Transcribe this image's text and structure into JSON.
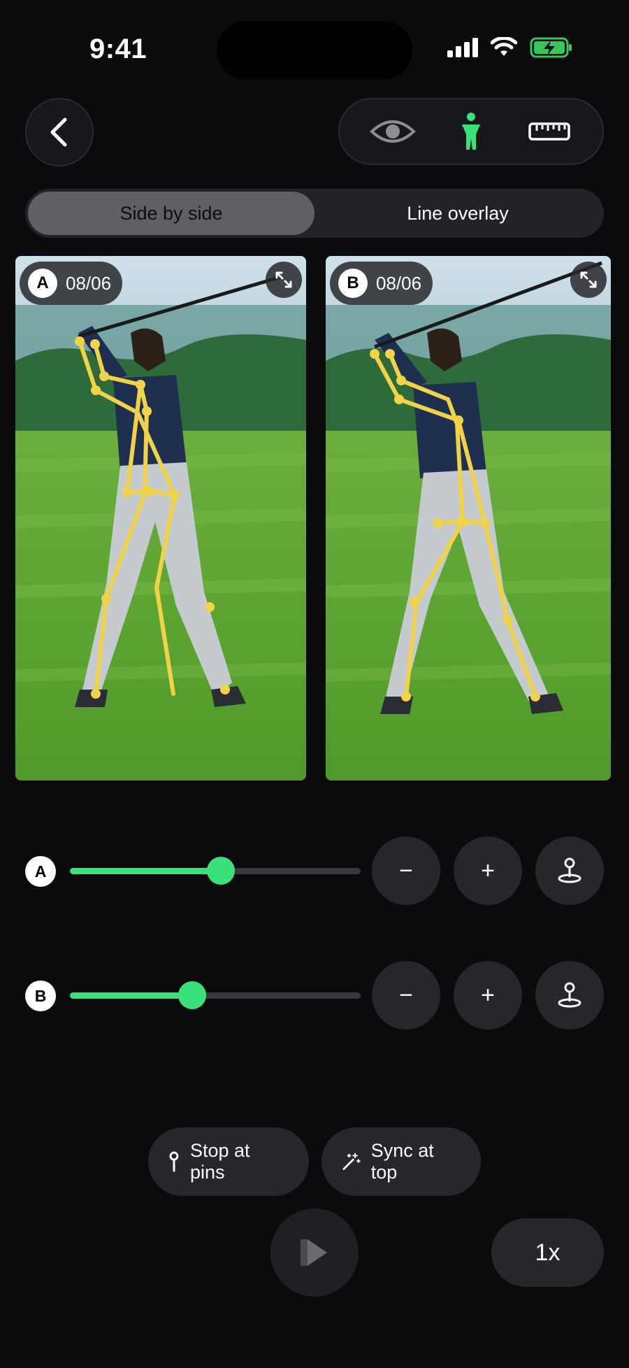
{
  "status_bar": {
    "time": "9:41"
  },
  "toolbar": {
    "back_icon": "chevron-left-icon",
    "tools": [
      "eye-icon",
      "person-icon",
      "ruler-icon"
    ],
    "accent_color": "#37e27a"
  },
  "view_mode": {
    "options": [
      "Side by side",
      "Line overlay"
    ],
    "selected": "Side by side"
  },
  "panels": [
    {
      "letter": "A",
      "date": "08/06"
    },
    {
      "letter": "B",
      "date": "08/06"
    }
  ],
  "scrubbers": [
    {
      "letter": "A",
      "position": 0.52,
      "minus_label": "−",
      "plus_label": "+"
    },
    {
      "letter": "B",
      "position": 0.42,
      "minus_label": "−",
      "plus_label": "+"
    }
  ],
  "actions": {
    "stop_at_pins": "Stop at pins",
    "sync_at_top": "Sync at top",
    "speed": "1x"
  }
}
